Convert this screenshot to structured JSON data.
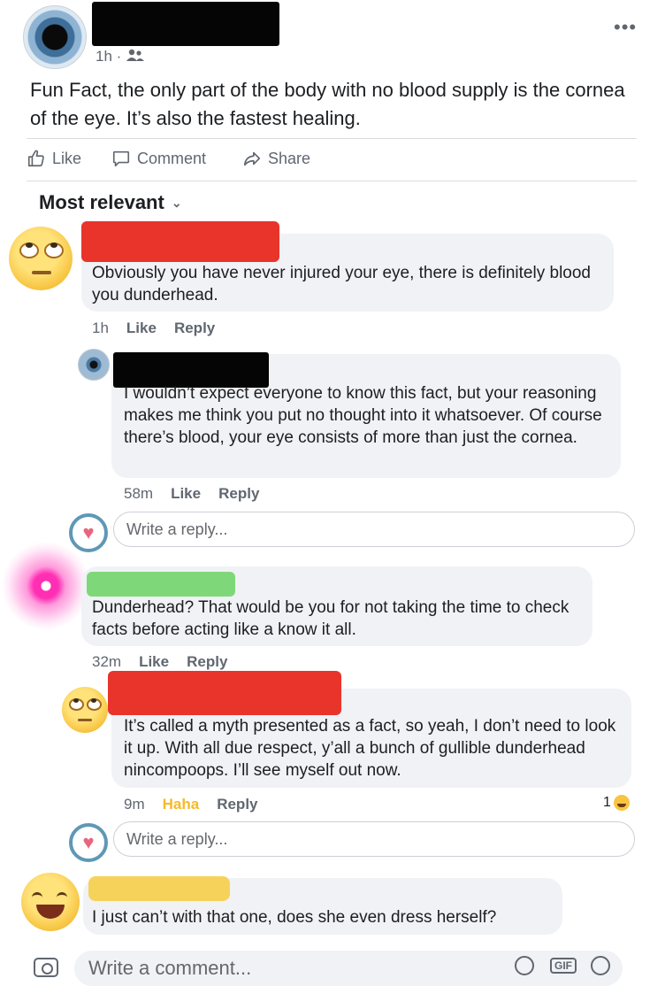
{
  "post": {
    "time": "1h",
    "separator": "·",
    "text": "Fun Fact, the only part of the body with no blood supply is the cornea of the eye. It’s also the fastest healing.",
    "more_label": "•••"
  },
  "actions": {
    "like": "Like",
    "comment": "Comment",
    "share": "Share"
  },
  "sort": {
    "label": "Most relevant",
    "chevron": "⌄"
  },
  "comments": [
    {
      "text": "Obviously you have never injured your eye, there is definitely blood you dunderhead.",
      "time": "1h",
      "like": "Like",
      "reply": "Reply"
    },
    {
      "text": "I wouldn’t expect everyone to know this fact, but your reasoning makes me think you put no thought into it whatsoever. Of course there’s blood, your eye consists of more than just the cornea.",
      "time": "58m",
      "like": "Like",
      "reply": "Reply"
    },
    {
      "text": "Dunderhead? That would be you for not taking the time to check facts before acting like a know it all.",
      "time": "32m",
      "like": "Like",
      "reply": "Reply"
    },
    {
      "text": "It’s called a myth presented as a fact, so yeah, I don’t need to look it up.  With all due respect, y’all a bunch of gullible dunderhead nincompoops. I’ll see myself out now.",
      "time": "9m",
      "like": "Haha",
      "reply": "Reply",
      "reaction_count": "1",
      "reaction_icon": "haha-emoji-icon"
    },
    {
      "text": "I just can’t with that one, does she even dress herself?"
    }
  ],
  "reply_placeholder": "Write a reply...",
  "comment_placeholder": "Write a comment...",
  "composer_icons": {
    "gif": "GIF"
  },
  "colors": {
    "haha": "#f7b928",
    "bubble": "#f0f2f5",
    "redact_red": "#e8342a",
    "redact_green": "#7ed87a",
    "redact_yellow": "#f6d25a"
  }
}
